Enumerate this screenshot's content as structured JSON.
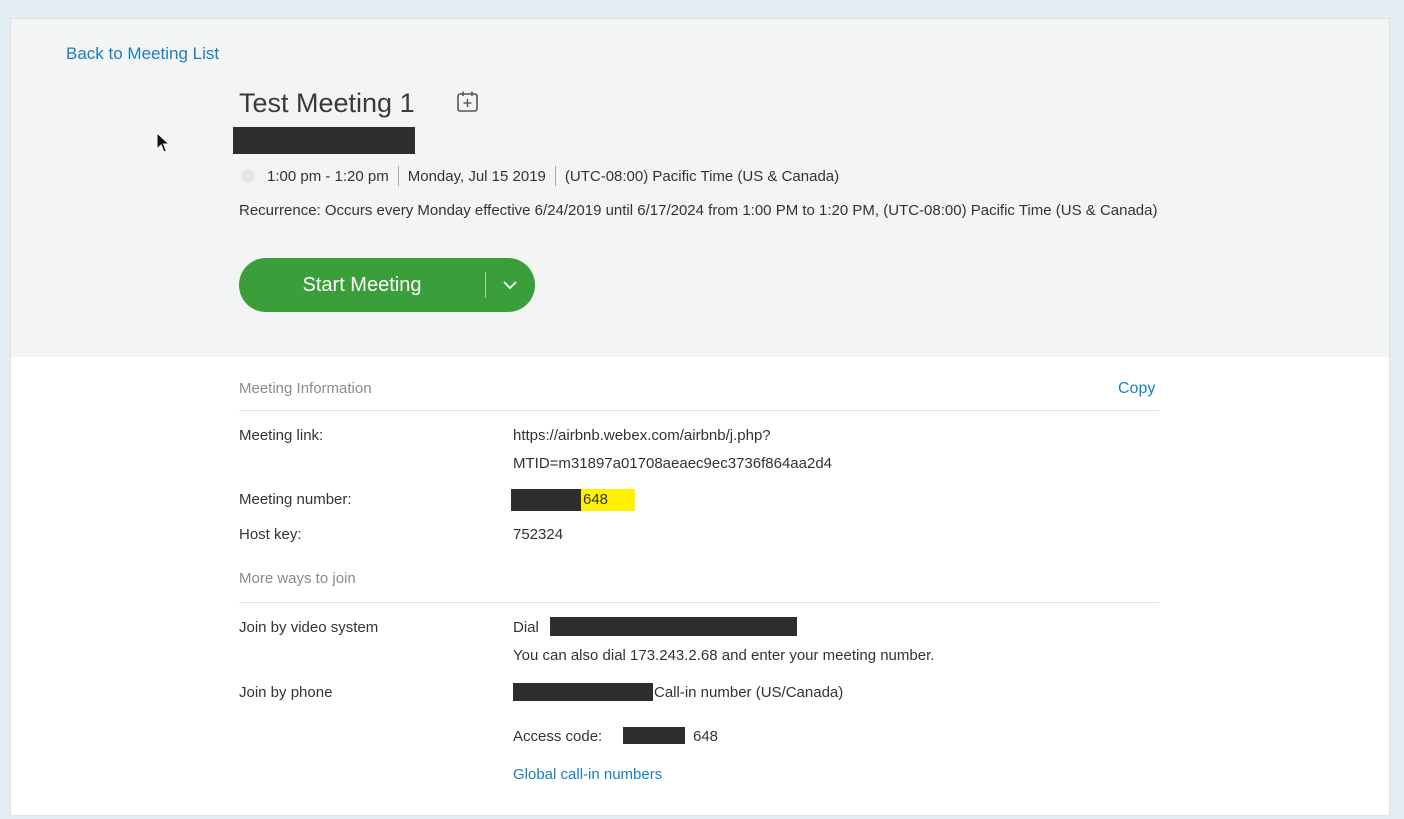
{
  "nav": {
    "back_label": "Back to Meeting List"
  },
  "meeting": {
    "title": "Test Meeting 1",
    "time_range": "1:00 pm - 1:20 pm",
    "date": "Monday, Jul 15 2019",
    "timezone": "(UTC-08:00) Pacific Time (US & Canada)",
    "recurrence": "Recurrence: Occurs every Monday effective 6/24/2019 until 6/17/2024 from 1:00 PM to 1:20 PM, (UTC-08:00) Pacific Time (US & Canada)"
  },
  "actions": {
    "start_label": "Start Meeting"
  },
  "info": {
    "section_title": "Meeting Information",
    "copy_label": "Copy",
    "link_label": "Meeting link:",
    "link_line1": "https://airbnb.webex.com/airbnb/j.php?",
    "link_line2": "MTID=m31897a01708aeaec9ec3736f864aa2d4",
    "number_label": "Meeting number:",
    "number_suffix": "648",
    "host_key_label": "Host key:",
    "host_key": "752324"
  },
  "join": {
    "section_title": "More ways to join",
    "video_label": "Join by video system",
    "video_dial_prefix": "Dial",
    "video_note": "You can also dial 173.243.2.68 and enter your meeting number.",
    "phone_label": "Join by phone",
    "phone_callin_text": "Call-in number (US/Canada)",
    "access_code_prefix": "Access code:",
    "access_code_suffix": "648",
    "global_link": "Global call-in numbers"
  },
  "colors": {
    "accent": "#1a7fc1",
    "start_button": "#3a9f3a",
    "highlight": "#fff200",
    "redaction": "#2e2e2e"
  },
  "icons": {
    "calendar": "calendar-add-icon",
    "chevron": "chevron-down-icon",
    "cursor": "mouse-pointer-icon"
  }
}
